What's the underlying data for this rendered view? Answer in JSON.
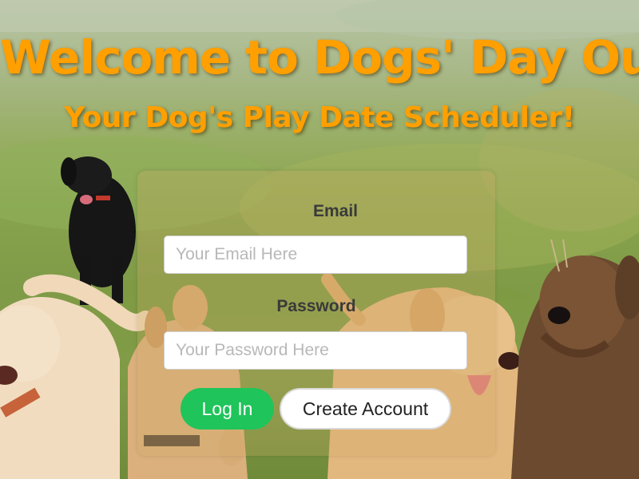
{
  "hero": {
    "title": "Welcome to Dogs' Day Out",
    "subtitle": "Your Dog's Play Date Scheduler!"
  },
  "login_form": {
    "email_label": "Email",
    "email_placeholder": "Your Email Here",
    "email_value": "",
    "password_label": "Password",
    "password_placeholder": "Your Password Here",
    "password_value": "",
    "login_button": "Log In",
    "create_account_button": "Create Account"
  },
  "colors": {
    "title": "#ff9f00",
    "login_button": "#1fc45a",
    "create_account_button": "#ffffff"
  },
  "background": {
    "description_icons": [
      "black-dog",
      "yellow-lab-left",
      "tan-dog-center",
      "yellow-lab-right",
      "brown-curly-dog"
    ]
  }
}
